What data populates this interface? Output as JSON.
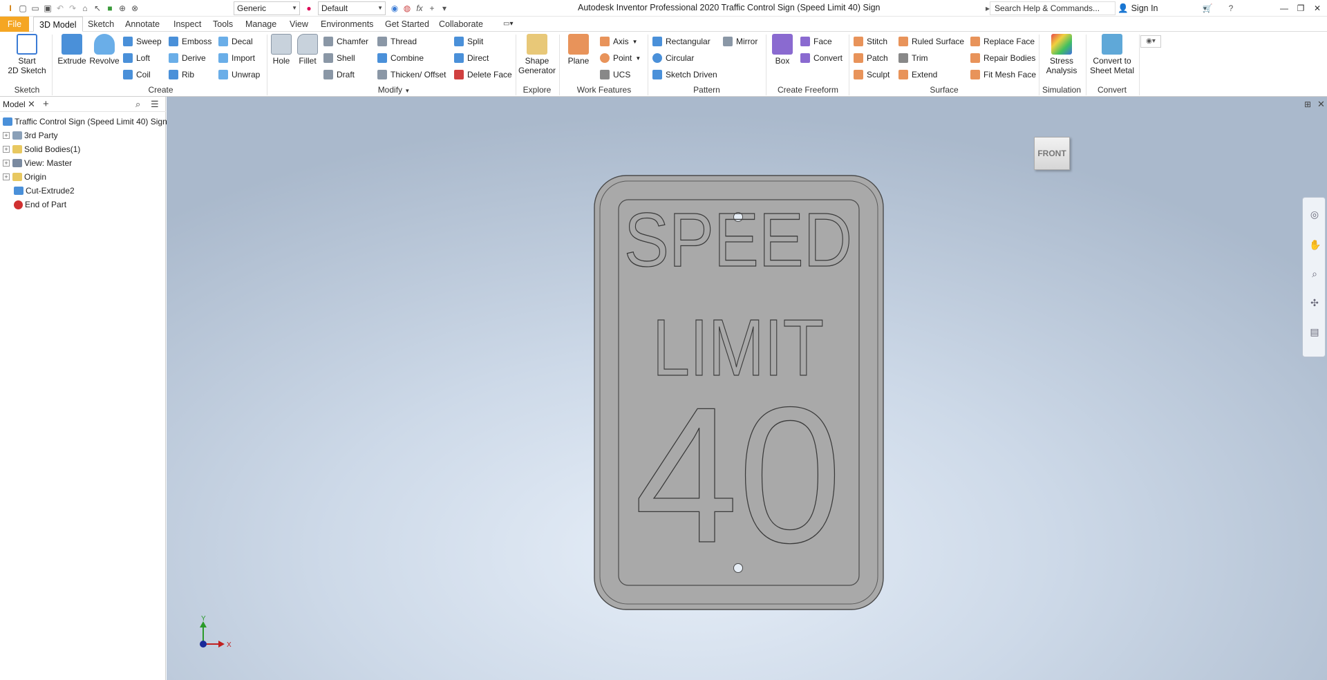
{
  "titlebar": {
    "app_title": "Autodesk Inventor Professional 2020   Traffic Control Sign (Speed Limit 40) Sign",
    "material": "Generic",
    "appearance": "Default",
    "search_placeholder": "Search Help & Commands...",
    "sign_in": "Sign In"
  },
  "tabs": [
    {
      "label": "File"
    },
    {
      "label": "3D Model"
    },
    {
      "label": "Sketch"
    },
    {
      "label": "Annotate"
    },
    {
      "label": "Inspect"
    },
    {
      "label": "Tools"
    },
    {
      "label": "Manage"
    },
    {
      "label": "View"
    },
    {
      "label": "Environments"
    },
    {
      "label": "Get Started"
    },
    {
      "label": "Collaborate"
    }
  ],
  "ribbon": {
    "sketch": {
      "panel": "Sketch",
      "start_line1": "Start",
      "start_line2": "2D Sketch"
    },
    "create": {
      "panel": "Create",
      "extrude": "Extrude",
      "revolve": "Revolve",
      "sweep": "Sweep",
      "loft": "Loft",
      "coil": "Coil",
      "emboss": "Emboss",
      "derive": "Derive",
      "rib": "Rib",
      "decal": "Decal",
      "import": "Import",
      "unwrap": "Unwrap"
    },
    "modify": {
      "panel": "Modify",
      "hole": "Hole",
      "fillet": "Fillet",
      "chamfer": "Chamfer",
      "shell": "Shell",
      "draft": "Draft",
      "thread": "Thread",
      "combine": "Combine",
      "thicken": "Thicken/ Offset",
      "split": "Split",
      "direct": "Direct",
      "delete_face": "Delete Face"
    },
    "explore": {
      "panel": "Explore",
      "shape_line1": "Shape",
      "shape_line2": "Generator"
    },
    "work": {
      "panel": "Work Features",
      "plane": "Plane",
      "axis": "Axis",
      "point": "Point",
      "ucs": "UCS"
    },
    "pattern": {
      "panel": "Pattern",
      "rectangular": "Rectangular",
      "circular": "Circular",
      "sketch_driven": "Sketch Driven",
      "mirror": "Mirror"
    },
    "freeform": {
      "panel": "Create Freeform",
      "box": "Box",
      "face": "Face",
      "convert": "Convert"
    },
    "surface": {
      "panel": "Surface",
      "stitch": "Stitch",
      "patch": "Patch",
      "sculpt": "Sculpt",
      "ruled": "Ruled Surface",
      "trim": "Trim",
      "extend": "Extend",
      "replace": "Replace Face",
      "repair": "Repair Bodies",
      "fit": "Fit Mesh Face"
    },
    "simulation": {
      "panel": "Simulation",
      "line1": "Stress",
      "line2": "Analysis"
    },
    "convert": {
      "panel": "Convert",
      "line1": "Convert to",
      "line2": "Sheet Metal"
    }
  },
  "browser": {
    "tab": "Model",
    "tree": [
      {
        "label": "Traffic Control Sign (Speed Limit 40) Sign"
      },
      {
        "label": "3rd Party"
      },
      {
        "label": "Solid Bodies(1)"
      },
      {
        "label": "View: Master"
      },
      {
        "label": "Origin"
      },
      {
        "label": "Cut-Extrude2"
      },
      {
        "label": "End of Part"
      }
    ]
  },
  "viewport": {
    "viewcube": "FRONT",
    "sign_line1": "SPEED",
    "sign_line2": "LIMIT",
    "sign_number": "40",
    "axis_y": "Y",
    "axis_x": "X"
  },
  "colors": {
    "file_tab": "#f5a623",
    "sign_fill": "#a9a9a9",
    "sign_stroke": "#4a4a4a",
    "viewport_center": "#e6eef8",
    "viewport_edge": "#aab9cc"
  }
}
